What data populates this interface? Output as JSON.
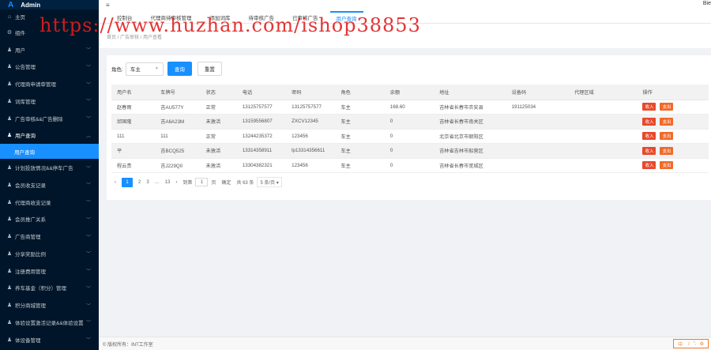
{
  "app": {
    "logo": "A",
    "name": "Admin",
    "user": "Bie"
  },
  "sidebar": {
    "items": [
      {
        "icon": "home",
        "label": "主页"
      },
      {
        "icon": "component",
        "label": "组件"
      },
      {
        "icon": "user",
        "label": "用户"
      },
      {
        "icon": "user",
        "label": "公告管理"
      },
      {
        "icon": "user",
        "label": "代理商申请审管理"
      },
      {
        "icon": "user",
        "label": "词库管理"
      },
      {
        "icon": "user",
        "label": "广告审核&&广告删除"
      },
      {
        "icon": "user",
        "label": "用户查询",
        "open": true
      },
      {
        "icon": "user",
        "label": "计划投放情况&&停车广告"
      },
      {
        "icon": "user",
        "label": "会员收支记录"
      },
      {
        "icon": "user",
        "label": "代理商收支记录"
      },
      {
        "icon": "user",
        "label": "会员推广关系"
      },
      {
        "icon": "user",
        "label": "广告商管理"
      },
      {
        "icon": "user",
        "label": "分享奖励比例"
      },
      {
        "icon": "user",
        "label": "注册费用管理"
      },
      {
        "icon": "user",
        "label": "养车基金（积分）管理"
      },
      {
        "icon": "user",
        "label": "积分商城管理"
      },
      {
        "icon": "user",
        "label": "体验设置激活记录&&体验设置"
      },
      {
        "icon": "user",
        "label": "体设备管理"
      }
    ],
    "sub_item": "用户查询"
  },
  "header": {
    "menu_icon": "≡"
  },
  "tabs": [
    "控制台",
    "代理商待审核管理",
    "添加词库",
    "待审核广告",
    "已审核广告",
    "用户查询"
  ],
  "active_tab": 5,
  "breadcrumb": "首页 / 广告审核 / 用户查看",
  "filter": {
    "label": "角色:",
    "value": "车主",
    "search": "查询",
    "reset": "重置"
  },
  "table": {
    "headers": [
      "用户名",
      "车牌号",
      "状态",
      "电话",
      "密码",
      "角色",
      "余额",
      "地址",
      "设备码",
      "代理区域",
      "操作"
    ],
    "rows": [
      [
        "赵春雨",
        "吉AU577Y",
        "正常",
        "13125757577",
        "13125757577",
        "车主",
        "168.60",
        "吉林省长春市农安县",
        "191125034",
        ""
      ],
      [
        "邱国隆",
        "吉A6A23M",
        "未激活",
        "13159556807",
        "ZXCV12345",
        "车主",
        "0",
        "吉林省长春市南关区",
        "",
        ""
      ],
      [
        "111",
        "111",
        "正常",
        "13244235372",
        "123456",
        "车主",
        "0",
        "北京省北京市朝阳区",
        "",
        ""
      ],
      [
        "平",
        "吉BCQ525",
        "未激活",
        "13314358911",
        "lp13314356611",
        "车主",
        "0",
        "吉林省吉林市船营区",
        "",
        ""
      ],
      [
        "程云贵",
        "吉J229Q0",
        "未激活",
        "13304382321",
        "123456",
        "车主",
        "0",
        "吉林省长春市宽城区",
        "",
        ""
      ]
    ],
    "actions": {
      "income": "收入",
      "expense": "支出"
    }
  },
  "pager": {
    "prev": "‹",
    "current": "1",
    "pages": [
      "2",
      "3"
    ],
    "ellipsis": "…",
    "last": "13",
    "next": "›",
    "goto_label": "到第",
    "goto_value": "1",
    "page_unit": "页",
    "confirm": "确定",
    "total": "共 63 条",
    "per_page": "5 条/页"
  },
  "footer": "© 版权所有：INT工作室",
  "watermark": "https://www.huzhan.com/ishop38853",
  "ime_toolbar": [
    "中",
    "☽",
    "°,",
    "⚙"
  ]
}
